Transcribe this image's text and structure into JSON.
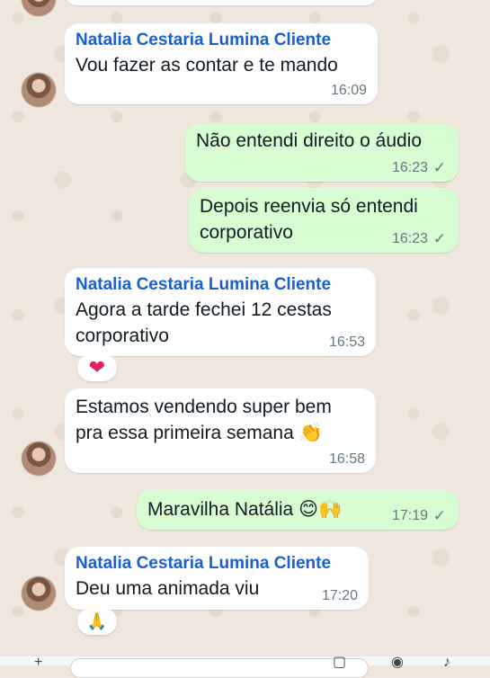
{
  "chat": {
    "messages": [
      {
        "sender": "Natalia Cestaria Lumina Cliente",
        "lines": [
          "Vou fazer as contar e te mando"
        ],
        "time": "16:09"
      },
      {
        "lines": [
          "Não entendi direito o áudio"
        ],
        "time": "16:23",
        "status": "✓"
      },
      {
        "lines": [
          "Depois reenvia só entendi",
          "corporativo"
        ],
        "time": "16:23",
        "status": "✓"
      },
      {
        "sender": "Natalia Cestaria Lumina Cliente",
        "lines": [
          "Agora a tarde fechei 12 cestas",
          "corporativo"
        ],
        "time": "16:53",
        "reaction": "❤"
      },
      {
        "lines": [
          "Estamos vendendo super bem",
          "pra essa primeira semana 👏"
        ],
        "time": "16:58"
      },
      {
        "lines": [
          "Maravilha Natália 😊🙌"
        ],
        "time": "17:19",
        "status": "✓"
      },
      {
        "sender": "Natalia Cestaria Lumina Cliente",
        "lines": [
          "Deu uma animada viu"
        ],
        "time": "17:20",
        "reaction": "🙏"
      }
    ]
  },
  "colors": {
    "incoming_bubble": "#ffffff",
    "outgoing_bubble": "#d9fdd3",
    "sender_name": "#1a5fcf",
    "wallpaper": "#efe7dd"
  },
  "icons": [
    "avatar",
    "read-check-icon",
    "heart-reaction",
    "pray-reaction",
    "plus-icon",
    "camera-icon",
    "mic-icon"
  ]
}
